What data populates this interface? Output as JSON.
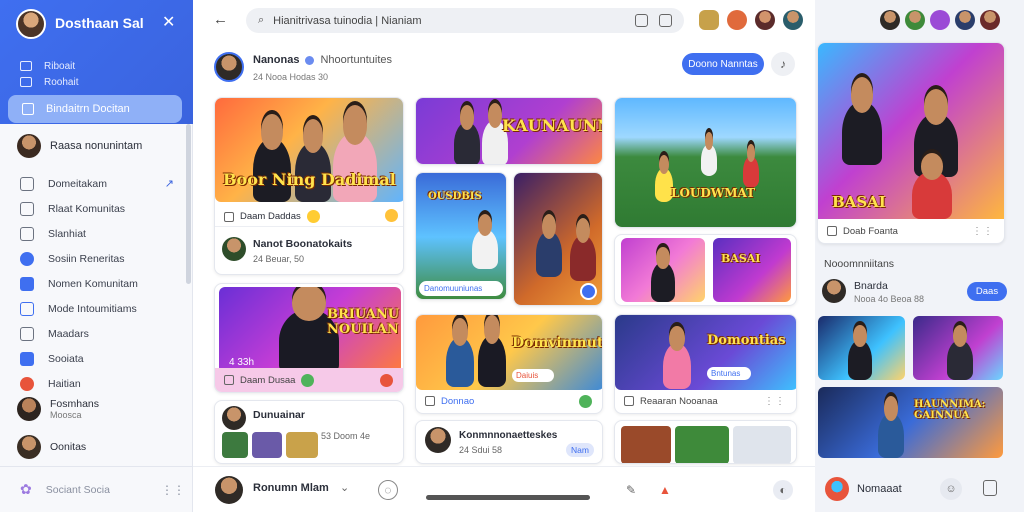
{
  "app": {
    "title": "Dosthaan Sal"
  },
  "sidebar": {
    "top_items": [
      {
        "label": "Riboait"
      },
      {
        "label": "Roohait"
      }
    ],
    "active_item": {
      "label": "Bindaitrn Docitan"
    },
    "profile": {
      "name": "Raasa nonunintam"
    },
    "items": [
      {
        "label": "Domeitakam",
        "color": "#6b7280"
      },
      {
        "label": "Rlaat Komunitas",
        "color": "#6b7280"
      },
      {
        "label": "Slanhiat",
        "color": "#6b7280"
      },
      {
        "label": "Sosiin Reneritas",
        "color": "#3f6ff0"
      },
      {
        "label": "Nomen Komunitam",
        "color": "#3f6ff0"
      },
      {
        "label": "Mode Intoumitiams",
        "color": "#3f6ff0"
      },
      {
        "label": "Maadars",
        "color": "#6b7280"
      },
      {
        "label": "Sooiata",
        "color": "#3f6ff0"
      },
      {
        "label": "Haitian",
        "color": "#e8543b"
      }
    ],
    "users": [
      {
        "name": "Fosmhans",
        "sub": "Moosca"
      },
      {
        "name": "Oonitas"
      }
    ],
    "footer_label": "Sociant Socia"
  },
  "header": {
    "search_value": "Hianitrivasa tuinodia | Nianiam"
  },
  "post": {
    "author": "Nanonas",
    "community": "Nhoortuntuites",
    "meta": "24 Nooa Hodas 30",
    "join_label": "Doono Nanntas"
  },
  "cards": {
    "c1": {
      "caption": "Boor Ning Dadimal",
      "bar_text": "Daam Daddas"
    },
    "c1_user": {
      "name": "Nanot Boonatokaits",
      "meta": "24 Beuar, 50"
    },
    "c2": {
      "caption": "BRIUANU NOUILAN",
      "overlay": "4 33h",
      "bar_text": "Daam Dusaa"
    },
    "c2_user": {
      "name": "Dunuainar",
      "meta": "53 Doom 4e"
    },
    "c3": {
      "caption": "KAUNAUNN"
    },
    "c4": {
      "caption": "OUSDBIS",
      "badge": "Danomuuniunas"
    },
    "c5": {
      "caption": "Domvinmutias",
      "badge": "Daiuis",
      "bar_text": "Donnao"
    },
    "c6": {
      "caption": "LOUDWMAT"
    },
    "c7": {
      "caption": "Domontias",
      "badge": "Bntunas",
      "bar_text": "Reaaran Nooanaa"
    },
    "c8": {
      "name": "Konmnnonaetteskes",
      "meta": "24 Sdui 58",
      "btn": "Nam"
    },
    "c9": {
      "caption": "BASAI",
      "bar_text": "Doab Foanta"
    }
  },
  "bottom": {
    "user": "Ronumn Mlam"
  },
  "right_panel": {
    "section_title": "Nooomnniitans",
    "user": {
      "name": "Bnarda",
      "meta": "Nooa 4o Beoa 88",
      "btn": "Daas"
    },
    "banner_caption": "HAUNNIMA: GAINNUA",
    "bottom_label": "Nomaaat"
  }
}
